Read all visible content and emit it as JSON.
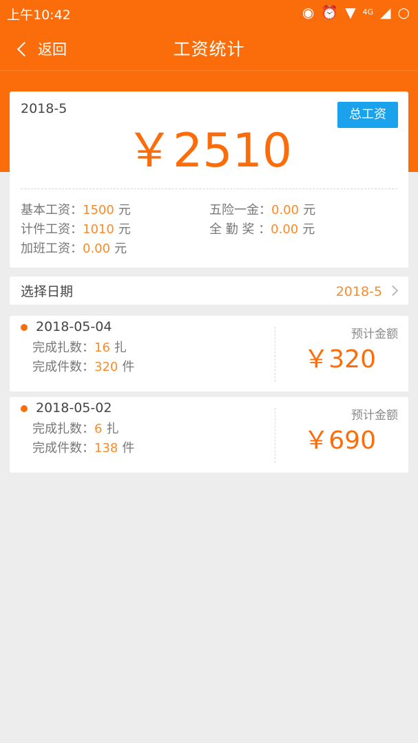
{
  "status_bar": {
    "time": "上午10:42",
    "icons": [
      "sync-icon",
      "alarm-icon",
      "wifi-icon",
      "4g-icon",
      "signal-icon",
      "battery-icon"
    ]
  },
  "nav": {
    "back_label": "返回",
    "title": "工资统计"
  },
  "summary": {
    "month": "2018-5",
    "badge": "总工资",
    "total": "￥2510",
    "items": {
      "base_label": "基本工资：",
      "base_value": "1500",
      "base_unit": "元",
      "piece_label": "计件工资：",
      "piece_value": "1010",
      "piece_unit": "元",
      "overtime_label": "加班工资：",
      "overtime_value": "0.00",
      "overtime_unit": "元",
      "insurance_label": "五险一金：",
      "insurance_value": "0.00",
      "insurance_unit": "元",
      "attendance_label": "全 勤 奖 ：",
      "attendance_value": "0.00",
      "attendance_unit": "元"
    }
  },
  "date_selector": {
    "label": "选择日期",
    "value": "2018-5"
  },
  "records": [
    {
      "date": "2018-05-04",
      "bundles_label": "完成扎数：",
      "bundles_value": "16",
      "bundles_unit": "扎",
      "pieces_label": "完成件数：",
      "pieces_value": "320",
      "pieces_unit": "件",
      "est_label": "预计金额",
      "amount": "￥320"
    },
    {
      "date": "2018-05-02",
      "bundles_label": "完成扎数：",
      "bundles_value": "6",
      "bundles_unit": "扎",
      "pieces_label": "完成件数：",
      "pieces_value": "138",
      "pieces_unit": "件",
      "est_label": "预计金额",
      "amount": "￥690"
    }
  ],
  "colors": {
    "brand_orange": "#fb6d0a",
    "value_orange": "#fb8a28",
    "badge_blue": "#1aa3ec",
    "page_bg": "#ededed"
  }
}
